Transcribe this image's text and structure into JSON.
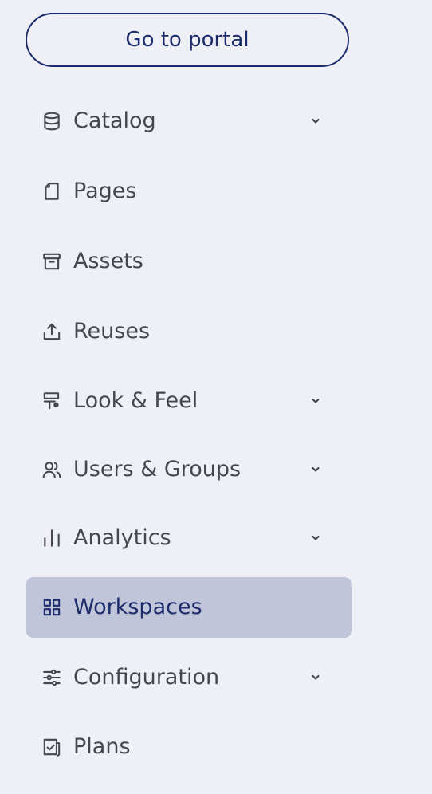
{
  "portal_button": {
    "label": "Go to portal"
  },
  "nav": {
    "items": [
      {
        "label": "Catalog",
        "icon": "database-icon",
        "expandable": true,
        "active": false
      },
      {
        "label": "Pages",
        "icon": "page-icon",
        "expandable": false,
        "active": false
      },
      {
        "label": "Assets",
        "icon": "archive-box-icon",
        "expandable": false,
        "active": false
      },
      {
        "label": "Reuses",
        "icon": "upload-icon",
        "expandable": false,
        "active": false
      },
      {
        "label": "Look & Feel",
        "icon": "paint-roller-icon",
        "expandable": true,
        "active": false
      },
      {
        "label": "Users & Groups",
        "icon": "users-icon",
        "expandable": true,
        "active": false
      },
      {
        "label": "Analytics",
        "icon": "bar-chart-icon",
        "expandable": true,
        "active": false
      },
      {
        "label": "Workspaces",
        "icon": "grid-icon",
        "expandable": false,
        "active": true
      },
      {
        "label": "Configuration",
        "icon": "sliders-icon",
        "expandable": true,
        "active": false
      },
      {
        "label": "Plans",
        "icon": "plan-checklist-icon",
        "expandable": false,
        "active": false
      }
    ]
  },
  "colors": {
    "background": "#eff0f6",
    "accent": "#1c2b6b",
    "active_background": "#c0c5da",
    "text": "#45464f"
  }
}
